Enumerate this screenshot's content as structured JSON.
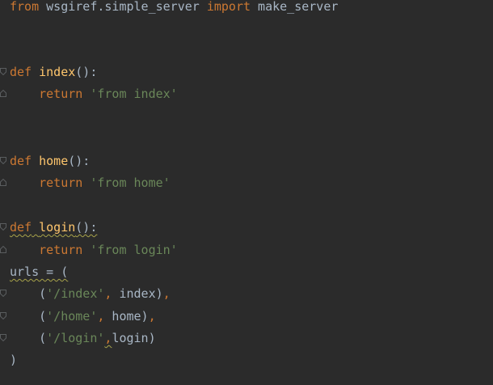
{
  "editor": {
    "lines": [
      {
        "tokens": [
          {
            "t": "from",
            "c": "kw"
          },
          {
            "t": " wsgiref.simple_server ",
            "c": "txt"
          },
          {
            "t": "import",
            "c": "kw"
          },
          {
            "t": " make_server",
            "c": "txt"
          }
        ]
      },
      {
        "tokens": []
      },
      {
        "tokens": []
      },
      {
        "tokens": [
          {
            "t": "def",
            "c": "kw"
          },
          {
            "t": " ",
            "c": "txt"
          },
          {
            "t": "index",
            "c": "fn"
          },
          {
            "t": "():",
            "c": "txt"
          }
        ]
      },
      {
        "tokens": [
          {
            "t": "    return",
            "c": "kw"
          },
          {
            "t": " ",
            "c": "txt"
          },
          {
            "t": "'from index'",
            "c": "str"
          }
        ]
      },
      {
        "tokens": []
      },
      {
        "tokens": []
      },
      {
        "tokens": [
          {
            "t": "def",
            "c": "kw"
          },
          {
            "t": " ",
            "c": "txt"
          },
          {
            "t": "home",
            "c": "fn"
          },
          {
            "t": "():",
            "c": "txt"
          }
        ]
      },
      {
        "tokens": [
          {
            "t": "    return",
            "c": "kw"
          },
          {
            "t": " ",
            "c": "txt"
          },
          {
            "t": "'from home'",
            "c": "str"
          }
        ]
      },
      {
        "tokens": []
      },
      {
        "tokens": [
          {
            "t": "def",
            "c": "kw wavy"
          },
          {
            "t": " ",
            "c": "txt wavy"
          },
          {
            "t": "login",
            "c": "fn wavy"
          },
          {
            "t": "():",
            "c": "txt wavy"
          }
        ]
      },
      {
        "tokens": [
          {
            "t": "    return",
            "c": "kw"
          },
          {
            "t": " ",
            "c": "txt"
          },
          {
            "t": "'from login'",
            "c": "str"
          }
        ]
      },
      {
        "tokens": [
          {
            "t": "urls = (",
            "c": "txt wavy"
          }
        ]
      },
      {
        "tokens": [
          {
            "t": "    (",
            "c": "txt"
          },
          {
            "t": "'/index'",
            "c": "str"
          },
          {
            "t": ",",
            "c": "kw"
          },
          {
            "t": " index)",
            "c": "txt"
          },
          {
            "t": ",",
            "c": "kw"
          }
        ]
      },
      {
        "tokens": [
          {
            "t": "    (",
            "c": "txt"
          },
          {
            "t": "'/home'",
            "c": "str"
          },
          {
            "t": ",",
            "c": "kw"
          },
          {
            "t": " home)",
            "c": "txt"
          },
          {
            "t": ",",
            "c": "kw"
          }
        ]
      },
      {
        "tokens": [
          {
            "t": "    (",
            "c": "txt"
          },
          {
            "t": "'/login'",
            "c": "str"
          },
          {
            "t": ",",
            "c": "kw wavy"
          },
          {
            "t": "login)",
            "c": "txt"
          }
        ]
      },
      {
        "tokens": [
          {
            "t": ")",
            "c": "txt"
          }
        ]
      }
    ],
    "line_tops": [
      0,
      27,
      54,
      81,
      108,
      136,
      163,
      191,
      218,
      246,
      273,
      301,
      328,
      355,
      383,
      410,
      437
    ],
    "fold_markers": {
      "3": "open",
      "4": "close",
      "7": "open",
      "8": "close",
      "10": "open",
      "11": "close",
      "13": "open",
      "14": "open",
      "15": "open"
    }
  },
  "colors": {
    "background": "#2b2b2b",
    "keyword": "#cc7832",
    "function": "#ffc66d",
    "string": "#6a8759",
    "text": "#a9b7c6",
    "fold_marker": "#5a5d5f"
  }
}
